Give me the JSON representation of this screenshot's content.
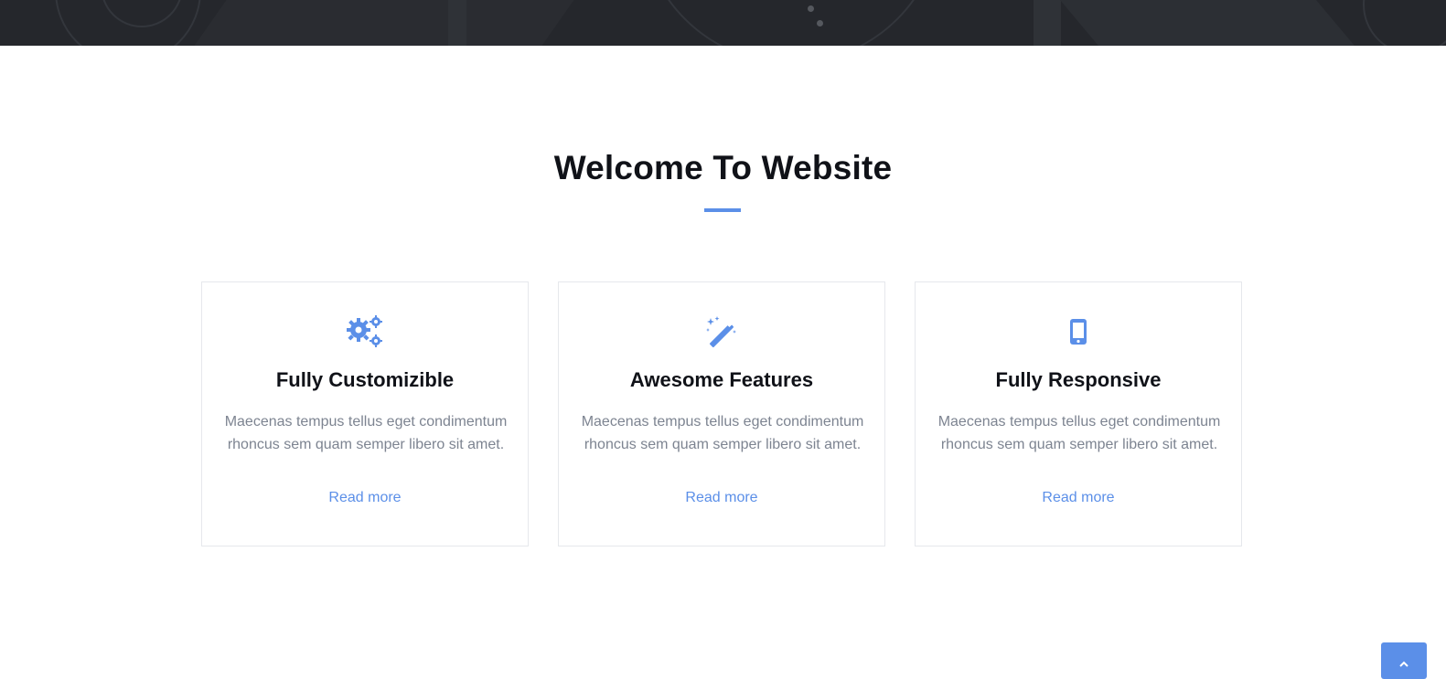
{
  "section": {
    "title": "Welcome To Website"
  },
  "colors": {
    "accent": "#5b8fe8",
    "heading": "#101218",
    "body_text": "#7d8491",
    "hero_background": "#25272c"
  },
  "cards": [
    {
      "icon": "gears-icon",
      "title": "Fully Customizible",
      "text": "Maecenas tempus tellus eget condimentum rhoncus sem quam semper libero sit amet.",
      "link": "Read more"
    },
    {
      "icon": "magic-wand-icon",
      "title": "Awesome Features",
      "text": "Maecenas tempus tellus eget condimentum rhoncus sem quam semper libero sit amet.",
      "link": "Read more"
    },
    {
      "icon": "mobile-phone-icon",
      "title": "Fully Responsive",
      "text": "Maecenas tempus tellus eget condimentum rhoncus sem quam semper libero sit amet.",
      "link": "Read more"
    }
  ],
  "back_to_top": {
    "icon": "chevron-up-icon"
  }
}
